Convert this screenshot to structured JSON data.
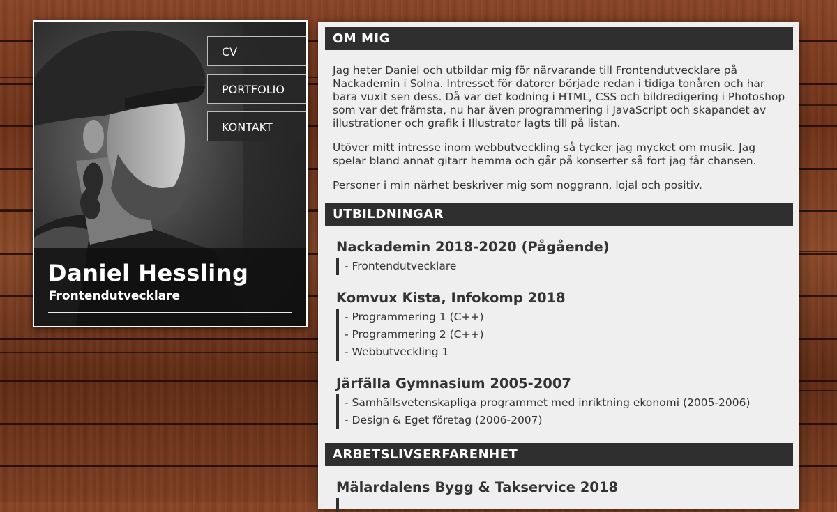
{
  "profile": {
    "name": "Daniel Hessling",
    "title": "Frontendutvecklare"
  },
  "nav": {
    "items": [
      {
        "label": "CV"
      },
      {
        "label": "PORTFOLIO"
      },
      {
        "label": "KONTAKT"
      }
    ]
  },
  "about": {
    "heading": "OM MIG",
    "paragraphs": [
      "Jag heter Daniel och utbildar mig för närvarande till Frontendutvecklare på Nackademin i Solna. Intresset för datorer började redan i tidiga tonåren och har bara vuxit sen dess. Då var det kodning i HTML, CSS och bildredigering i Photoshop som var det främsta, nu har även programmering i JavaScript och skapandet av illustrationer och grafik i Illustrator lagts till på listan.",
      "Utöver mitt intresse inom webbutveckling så tycker jag mycket om musik. Jag spelar bland annat gitarr hemma och går på konserter så fort jag får chansen.",
      "Personer i min närhet beskriver mig som noggrann, lojal och positiv."
    ]
  },
  "education": {
    "heading": "UTBILDNINGAR",
    "entries": [
      {
        "title": "Nackademin 2018-2020 (Pågående)",
        "items": [
          "- Frontendutvecklare"
        ]
      },
      {
        "title": "Komvux Kista, Infokomp 2018",
        "items": [
          "- Programmering 1 (C++)",
          "- Programmering 2 (C++)",
          "- Webbutveckling 1"
        ]
      },
      {
        "title": "Järfälla Gymnasium 2005-2007",
        "items": [
          "- Samhällsvetenskapliga programmet med inriktning ekonomi (2005-2006)",
          "- Design & Eget företag (2006-2007)"
        ]
      }
    ]
  },
  "work": {
    "heading": "ARBETSLIVSERFARENHET",
    "entries": [
      {
        "title": "Mälardalens Bygg & Takservice 2018"
      }
    ]
  }
}
